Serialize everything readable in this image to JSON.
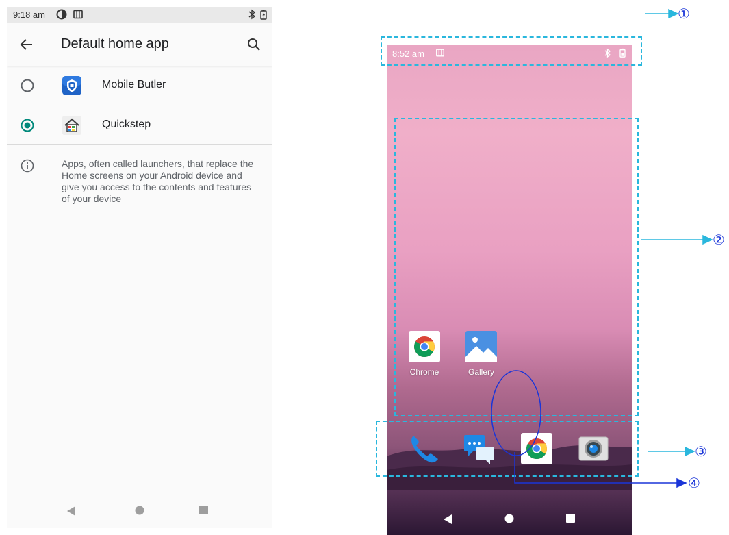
{
  "left_screen": {
    "status_time": "9:18 am",
    "title": "Default home app",
    "options": [
      {
        "label": "Mobile Butler",
        "selected": false
      },
      {
        "label": "Quickstep",
        "selected": true
      }
    ],
    "info_text": "Apps, often called launchers, that replace the Home screens on your Android device and give you access to the contents and features of your device",
    "accent_color": "#00897b"
  },
  "right_screen": {
    "status_time": "8:52 am",
    "apps": [
      {
        "name": "Chrome",
        "icon": "chrome-icon"
      },
      {
        "name": "Gallery",
        "icon": "gallery-icon"
      }
    ],
    "dock": [
      "phone-icon",
      "messages-icon",
      "chrome-icon",
      "camera-icon"
    ]
  },
  "annotations": {
    "callouts": [
      "①",
      "②",
      "③",
      "④"
    ],
    "dashed_color": "#2ab7dd",
    "callout_color": "#1a35d8"
  }
}
